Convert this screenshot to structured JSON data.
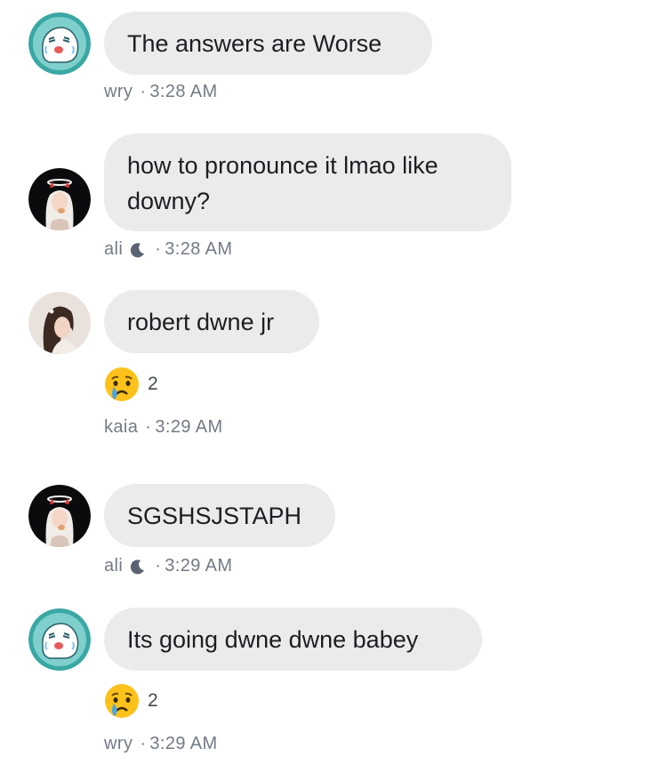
{
  "messages": [
    {
      "avatar": "ghost-avatar",
      "text": "The answers are Worse",
      "author": "wry",
      "dnd": false,
      "time": "3:28 AM"
    },
    {
      "avatar": "angel-devil-avatar",
      "text": "how to pronounce it lmao like downy?",
      "author": "ali",
      "dnd": true,
      "time": "3:28 AM"
    },
    {
      "avatar": "girl-avatar",
      "text": "robert dwne jr",
      "author": "kaia",
      "dnd": false,
      "time": "3:29 AM",
      "reaction": {
        "emoji": "crying-face",
        "count": "2"
      }
    },
    {
      "avatar": "angel-devil-avatar",
      "text": "SGSHSJSTAPH",
      "author": "ali",
      "dnd": true,
      "time": "3:29 AM"
    },
    {
      "avatar": "ghost-avatar",
      "text": "Its going dwne dwne babey",
      "author": "wry",
      "dnd": false,
      "time": "3:29 AM",
      "reaction": {
        "emoji": "crying-face",
        "count": "2"
      }
    }
  ],
  "separator": "·",
  "colors": {
    "bubble": "#ebebed",
    "meta_text": "#737a86",
    "text": "#1c1e21"
  }
}
